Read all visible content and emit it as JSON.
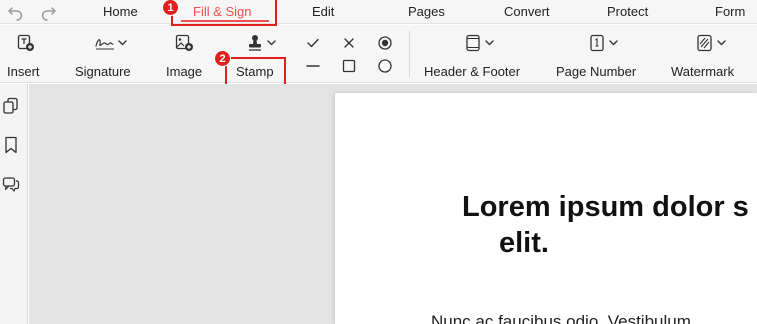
{
  "menu": {
    "items": [
      {
        "id": "home",
        "label": "Home"
      },
      {
        "id": "fill-sign",
        "label": "Fill & Sign",
        "active": true
      },
      {
        "id": "edit",
        "label": "Edit"
      },
      {
        "id": "pages",
        "label": "Pages"
      },
      {
        "id": "convert",
        "label": "Convert"
      },
      {
        "id": "protect",
        "label": "Protect"
      },
      {
        "id": "form",
        "label": "Form"
      }
    ],
    "accent_color": "#ef4f4f"
  },
  "ribbon": {
    "tools": [
      {
        "id": "insert",
        "label": "Insert",
        "icon": "insert-text-box-icon"
      },
      {
        "id": "signature",
        "label": "Signature",
        "icon": "signature-icon"
      },
      {
        "id": "image",
        "label": "Image",
        "icon": "image-add-icon"
      },
      {
        "id": "stamp",
        "label": "Stamp",
        "icon": "stamp-icon"
      },
      {
        "id": "header-footer",
        "label": "Header & Footer",
        "icon": "header-footer-icon"
      },
      {
        "id": "page-number",
        "label": "Page Number",
        "icon": "page-number-icon"
      },
      {
        "id": "watermark",
        "label": "Watermark",
        "icon": "watermark-icon"
      }
    ],
    "symbols": [
      "check-icon",
      "cross-icon",
      "radio-dot-icon",
      "line-icon",
      "square-icon",
      "circle-icon"
    ]
  },
  "annotations": {
    "badge_1": "1",
    "badge_2": "2",
    "highlight_color": "#e0201d"
  },
  "sidebar": {
    "icons": [
      "pages-thumbnail-icon",
      "bookmark-icon",
      "comments-icon"
    ]
  },
  "document": {
    "title_line1": "Lorem ipsum dolor s",
    "title_line2": "elit.",
    "body_line1": "Nunc ac faucibus odio. Vestibulum"
  }
}
